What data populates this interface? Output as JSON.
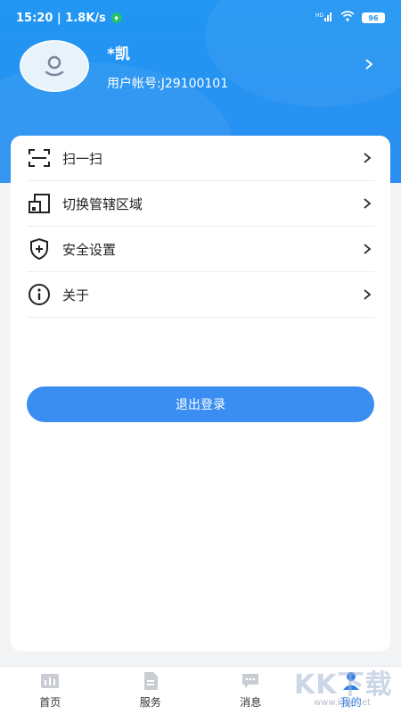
{
  "status_bar": {
    "time_speed": "15:20 | 1.8K/s",
    "signal": "5GHD",
    "battery": "96"
  },
  "profile": {
    "name": "*凯",
    "account": "用户帐号:J29100101"
  },
  "menu": {
    "items": [
      {
        "label": "扫一扫",
        "icon": "scan-icon"
      },
      {
        "label": "切换管辖区域",
        "icon": "switch-region-icon"
      },
      {
        "label": "安全设置",
        "icon": "shield-plus-icon"
      },
      {
        "label": "关于",
        "icon": "info-icon"
      }
    ]
  },
  "logout_label": "退出登录",
  "tabs": [
    {
      "label": "首页",
      "active": false
    },
    {
      "label": "服务",
      "active": false
    },
    {
      "label": "消息",
      "active": false
    },
    {
      "label": "我的",
      "active": true
    }
  ],
  "watermark": {
    "text": "KK下载",
    "url": "www.kkx.net"
  },
  "colors": {
    "primary": "#2196f3",
    "button": "#3a8ef2",
    "tab_active": "#2f7fe8"
  }
}
